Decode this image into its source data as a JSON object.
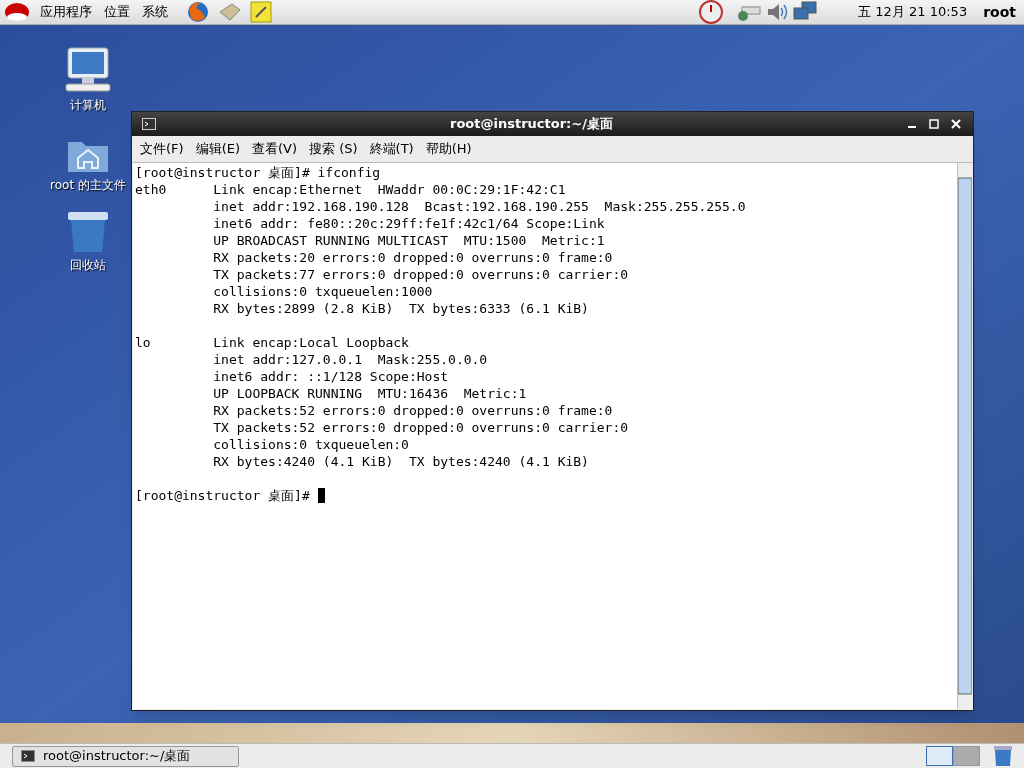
{
  "top_panel": {
    "menus": [
      "应用程序",
      "位置",
      "系统"
    ],
    "clock": "五 12月 21 10:53",
    "user": "root"
  },
  "desktop_icons": [
    {
      "kind": "computer",
      "label": "计算机"
    },
    {
      "kind": "home",
      "label": "root 的主文件"
    },
    {
      "kind": "trash",
      "label": "回收站"
    }
  ],
  "window": {
    "title": "root@instructor:~/桌面",
    "menu": [
      "文件(F)",
      "编辑(E)",
      "查看(V)",
      "搜索 (S)",
      "終端(T)",
      "帮助(H)"
    ],
    "terminal_blocks": [
      [
        "[root@instructor 桌面]# ifconfig",
        "eth0      Link encap:Ethernet  HWaddr 00:0C:29:1F:42:C1  ",
        "          inet addr:192.168.190.128  Bcast:192.168.190.255  Mask:255.255.255.0",
        "          inet6 addr: fe80::20c:29ff:fe1f:42c1/64 Scope:Link",
        "          UP BROADCAST RUNNING MULTICAST  MTU:1500  Metric:1",
        "          RX packets:20 errors:0 dropped:0 overruns:0 frame:0",
        "          TX packets:77 errors:0 dropped:0 overruns:0 carrier:0",
        "          collisions:0 txqueuelen:1000 ",
        "          RX bytes:2899 (2.8 KiB)  TX bytes:6333 (6.1 KiB)"
      ],
      [
        "lo        Link encap:Local Loopback  ",
        "          inet addr:127.0.0.1  Mask:255.0.0.0",
        "          inet6 addr: ::1/128 Scope:Host",
        "          UP LOOPBACK RUNNING  MTU:16436  Metric:1",
        "          RX packets:52 errors:0 dropped:0 overruns:0 frame:0",
        "          TX packets:52 errors:0 dropped:0 overruns:0 carrier:0",
        "          collisions:0 txqueuelen:0 ",
        "          RX bytes:4240 (4.1 KiB)  TX bytes:4240 (4.1 KiB)"
      ],
      [
        "[root@instructor 桌面]# "
      ]
    ]
  },
  "taskbar": {
    "tasks": [
      {
        "label": "root@instructor:~/桌面",
        "selected": false
      }
    ],
    "workspaces": [
      {
        "selected": true
      },
      {
        "selected": false
      }
    ]
  }
}
